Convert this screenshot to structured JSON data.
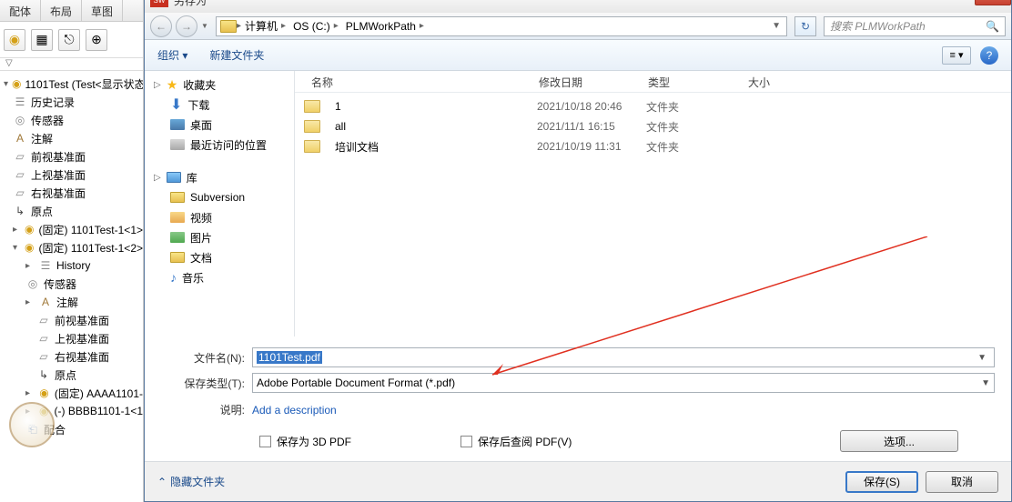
{
  "left_app": {
    "tabs": [
      "配体",
      "布局",
      "草图"
    ],
    "root": "1101Test  (Test<显示状态-",
    "items": [
      "历史记录",
      "传感器",
      "注解",
      "前视基准面",
      "上视基准面",
      "右视基准面",
      "原点",
      "(固定) 1101Test-1<1>",
      "(固定) 1101Test-1<2>"
    ],
    "sub_items": [
      "History",
      "传感器",
      "注解",
      "前视基准面",
      "上视基准面",
      "右视基准面",
      "原点",
      "(固定) AAAA1101-",
      "(-) BBBB1101-1<1"
    ],
    "last": "配合"
  },
  "dialog": {
    "title": "另存为",
    "breadcrumb": [
      "计算机",
      "OS (C:)",
      "PLMWorkPath"
    ],
    "search_placeholder": "搜索 PLMWorkPath",
    "toolbar": {
      "organize": "组织",
      "newfolder": "新建文件夹"
    },
    "sidebar": {
      "favorites": "收藏夹",
      "fav_items": [
        "下载",
        "桌面",
        "最近访问的位置"
      ],
      "library": "库",
      "lib_items": [
        "Subversion",
        "视频",
        "图片",
        "文档",
        "音乐"
      ]
    },
    "columns": {
      "name": "名称",
      "date": "修改日期",
      "type": "类型",
      "size": "大小"
    },
    "files": [
      {
        "name": "1",
        "date": "2021/10/18 20:46",
        "type": "文件夹"
      },
      {
        "name": "all",
        "date": "2021/11/1 16:15",
        "type": "文件夹"
      },
      {
        "name": "培训文档",
        "date": "2021/10/19 11:31",
        "type": "文件夹"
      }
    ],
    "form": {
      "filename_label": "文件名(N):",
      "filename_value": "1101Test.pdf",
      "savetype_label": "保存类型(T):",
      "savetype_value": "Adobe Portable Document Format (*.pdf)",
      "desc_label": "说明:",
      "desc_link": "Add a description",
      "chk1": "保存为 3D PDF",
      "chk2": "保存后查阅 PDF(V)",
      "options_btn": "选项..."
    },
    "footer": {
      "hide": "隐藏文件夹",
      "save": "保存(S)",
      "cancel": "取消"
    }
  }
}
